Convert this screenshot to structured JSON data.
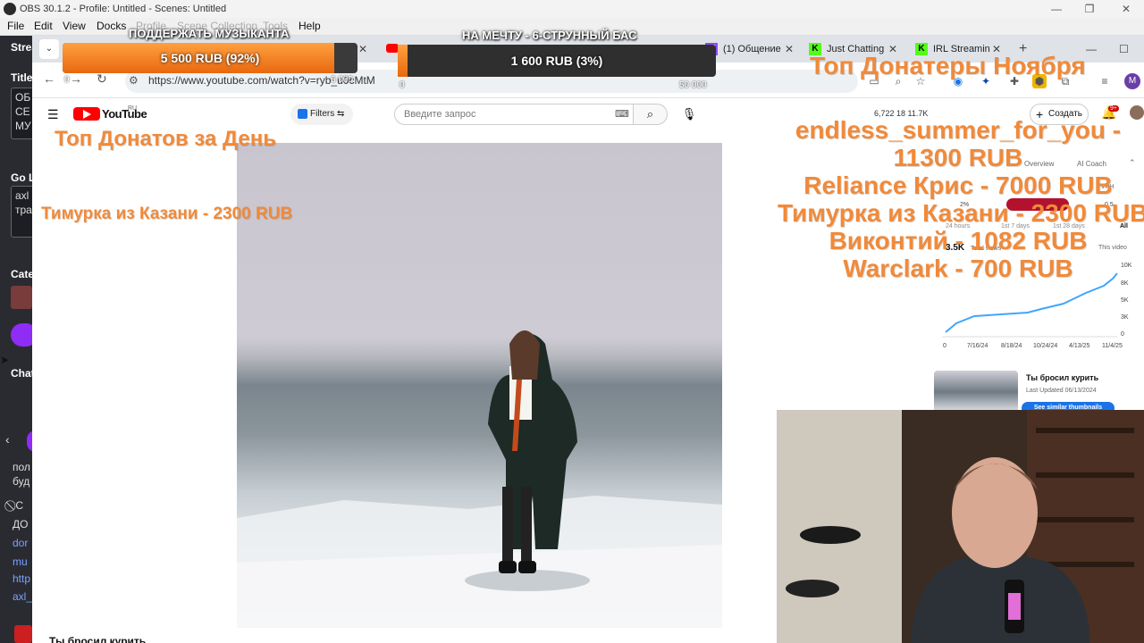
{
  "obs": {
    "title": "OBS 30.1.2 - Profile: Untitled - Scenes: Untitled",
    "menu": [
      "File",
      "Edit",
      "View",
      "Docks",
      "Profile",
      "Scene Collection",
      "Tools",
      "Help"
    ],
    "dock": {
      "stream_label": "Strea",
      "title_label": "Title",
      "title_lines": [
        "ОБ",
        "СЕ",
        "МУ"
      ],
      "golive_label": "Go L",
      "golive_lines": [
        "axl",
        "тра"
      ],
      "category_label": "Cate",
      "chat_label": "Chat",
      "chat_lines": [
        "пол",
        "буд",
        "⃠ С",
        "ДО",
        "dor",
        "mu",
        "http",
        "axl_"
      ]
    }
  },
  "browser": {
    "tabs": [
      {
        "label": "(1) Общение",
        "icon": "twitch-icon"
      },
      {
        "label": "Just Chatting",
        "icon": "kick-icon"
      },
      {
        "label": "IRL Streamin",
        "icon": "kick-icon"
      }
    ],
    "url": "https://www.youtube.com/watch?v=ryb_u0cMtM"
  },
  "youtube": {
    "logo_text": "YouTube",
    "region": "RU",
    "filters_label": "Filters",
    "search_placeholder": "Введите запрос",
    "stats": "6,722   18   11.7K",
    "create_label": "Создать",
    "notif_count": "9+",
    "below_video_title": "Ты бросил курить",
    "side_tabs": [
      "Overview",
      "AI Coach"
    ],
    "side_range": [
      "24 hours",
      "1st 7 days",
      "1st 28 days",
      "All"
    ],
    "side_metric": "3.5K",
    "side_total": "Total views",
    "side_this_video": "This video",
    "side_pct": "2%",
    "side_vph": "VPH",
    "side_vph_val": "0.5",
    "chart_y_ticks": [
      "10K",
      "8K",
      "5K",
      "3K",
      "0"
    ],
    "chart_x_ticks": [
      "0",
      "7/16/24",
      "8/18/24",
      "10/24/24",
      "4/13/25",
      "11/4/25"
    ],
    "rec_title": "Ты бросил курить",
    "rec_date": "Last Updated 06/13/2024",
    "rec_button": "See similar thumbnails"
  },
  "overlays": {
    "goal1_title": "ПОДДЕРЖАТЬ МУЗЫКАНТА",
    "goal1_value": "5 500 RUB (92%)",
    "goal1_progress": 0.92,
    "goal2_title": "НА МЕЧТУ - 6-СТРУННЫЙ БАС",
    "goal2_value": "1 600 RUB (3%)",
    "goal2_progress": 0.03,
    "goal2_min": "0",
    "goal2_max": "50 000",
    "goal1_min": "0",
    "goal1_max": "6 000",
    "top_day_title": "Топ Донатов за День",
    "top_day_entry": "Тимурка из Казани - 2300 RUB",
    "top_month_title": "Топ Донатеры Ноября",
    "top_month_entries": [
      "endless_summer_for_you -",
      "11300 RUB",
      "Reliance Крис - 7000 RUB",
      "Тимурка из Казани - 2300 RUB",
      "Виконтий - 1082 RUB",
      "Warclark - 700 RUB"
    ]
  },
  "colors": {
    "accent_orange": "#f08a3a",
    "youtube_red": "#ff0000",
    "obs_dock": "#2a2b31"
  }
}
